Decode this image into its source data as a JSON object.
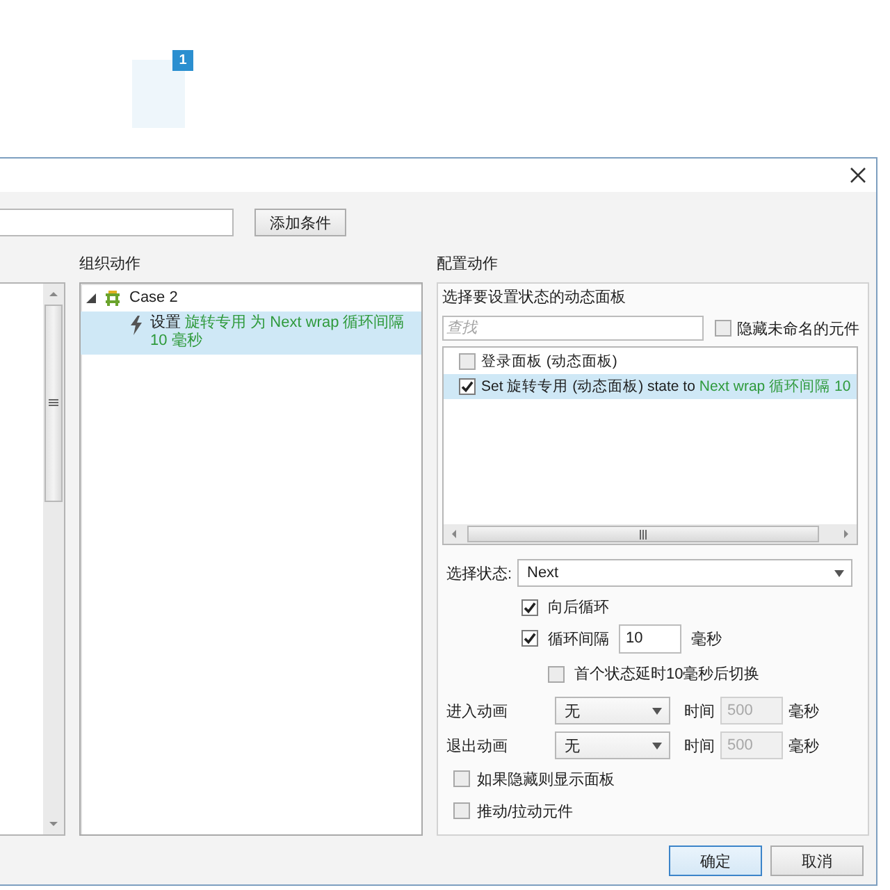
{
  "canvas": {
    "badge": "1"
  },
  "dialog": {
    "add_condition_button": "添加条件",
    "organize": {
      "heading": "组织动作",
      "tree": [
        {
          "kind": "case",
          "parts": [
            {
              "kind": "plain",
              "text": "Case 2"
            }
          ],
          "expanded": true,
          "selected": false,
          "children": [
            {
              "kind": "action",
              "parts": [
                {
                  "kind": "plain",
                  "text": "设置"
                },
                {
                  "kind": "target",
                  "text": "旋转专用 为 Next wrap 循环间隔 10 毫秒"
                }
              ],
              "selected": true
            }
          ]
        }
      ]
    },
    "configure": {
      "heading": "配置动作",
      "prompt": "选择要设置状态的动态面板",
      "search": {
        "placeholder": "查找"
      },
      "hide_unnamed": {
        "label": "隐藏未命名的元件",
        "checked": false
      },
      "panels": [
        {
          "parts": [
            {
              "kind": "plain",
              "text": "登录面板 (动态面板)"
            }
          ],
          "checked": false,
          "selected": false
        },
        {
          "parts": [
            {
              "kind": "plain",
              "text": "Set 旋转专用 (动态面板) state to"
            },
            {
              "kind": "target",
              "text": "Next wrap 循环间隔 10"
            }
          ],
          "checked": true,
          "selected": true
        }
      ],
      "state": {
        "label": "选择状态:",
        "value": "Next"
      },
      "options": [
        {
          "label": "向后循环",
          "checked": true
        },
        {
          "label": "循环间隔",
          "checked": true,
          "value": "10",
          "unit": "毫秒",
          "children": [
            {
              "label": "首个状态延时10毫秒后切换",
              "checked": false
            }
          ]
        }
      ],
      "animations": [
        {
          "label": "进入动画",
          "effect": "无",
          "time_label": "时间",
          "time": {
            "value": "500",
            "disabled": true
          },
          "unit": "毫秒"
        },
        {
          "label": "退出动画",
          "effect": "无",
          "time_label": "时间",
          "time": {
            "value": "500",
            "disabled": true
          },
          "unit": "毫秒"
        }
      ],
      "extras": [
        {
          "label": "如果隐藏则显示面板",
          "checked": false
        },
        {
          "label": "推动/拉动元件",
          "checked": false
        }
      ]
    },
    "buttons": [
      {
        "label": "确定",
        "default": true
      },
      {
        "label": "取消",
        "default": false
      }
    ]
  }
}
